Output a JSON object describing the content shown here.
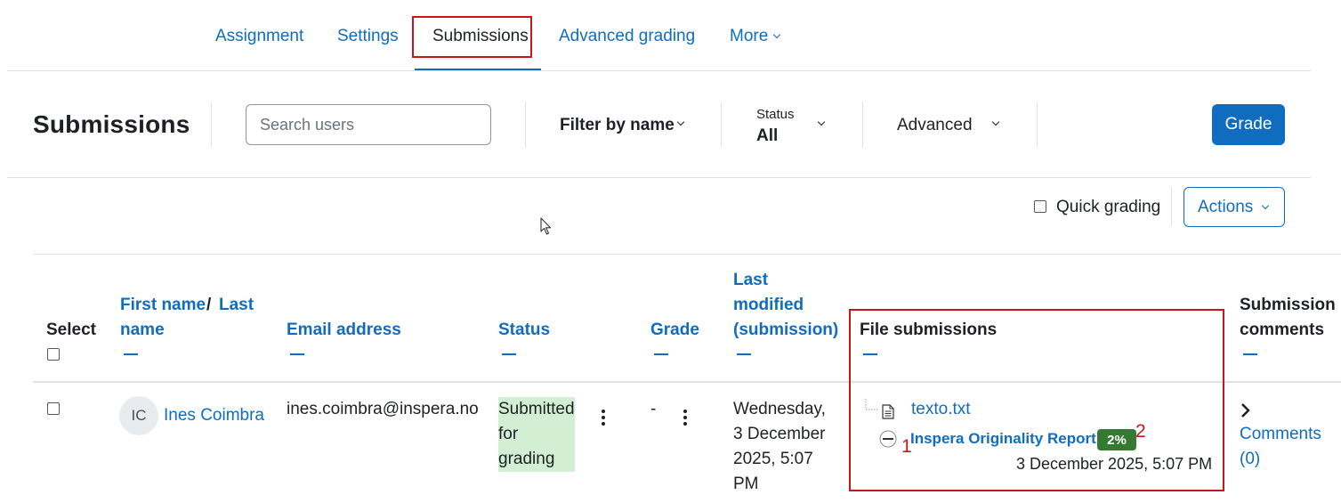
{
  "nav": {
    "tabs": [
      {
        "label": "Assignment"
      },
      {
        "label": "Settings"
      },
      {
        "label": "Submissions"
      },
      {
        "label": "Advanced grading"
      },
      {
        "label": "More"
      }
    ]
  },
  "header": {
    "title": "Submissions",
    "search_placeholder": "Search users",
    "filter_by_name": "Filter by name",
    "status_caption": "Status",
    "status_value": "All",
    "advanced": "Advanced",
    "grade_button": "Grade"
  },
  "toolbar": {
    "quick_grading": "Quick grading",
    "actions": "Actions"
  },
  "table": {
    "headers": {
      "select": "Select",
      "first_name": "First name",
      "slash": "/",
      "last_name_1": "Last",
      "last_name_2": "name",
      "email": "Email address",
      "status": "Status",
      "grade": "Grade",
      "last_modified_1": "Last",
      "last_modified_2": "modified",
      "last_modified_3": "(submission)",
      "file_submissions": "File submissions",
      "submission_comments_1": "Submission",
      "submission_comments_2": "comments"
    },
    "rows": [
      {
        "initials": "IC",
        "name": "Ines Coimbra",
        "email": "ines.coimbra@inspera.no",
        "status_lines": [
          "Submitted",
          "for",
          "grading"
        ],
        "grade": "-",
        "modified_lines": [
          "Wednesday,",
          "3 December",
          "2025, 5:07",
          "PM"
        ],
        "file_name": "texto.txt",
        "report_label": "Inspera Originality Report",
        "report_score": "2%",
        "report_date": "3 December 2025, 5:07 PM",
        "comments_label": "Comments",
        "comments_count": "(0)"
      }
    ]
  },
  "annotations": {
    "marker_1": "1",
    "marker_2": "2"
  },
  "colors": {
    "link": "#0f6cbf",
    "highlight_box": "#c8171c",
    "status_bg": "#d2efd3",
    "score_badge": "#357a32"
  }
}
